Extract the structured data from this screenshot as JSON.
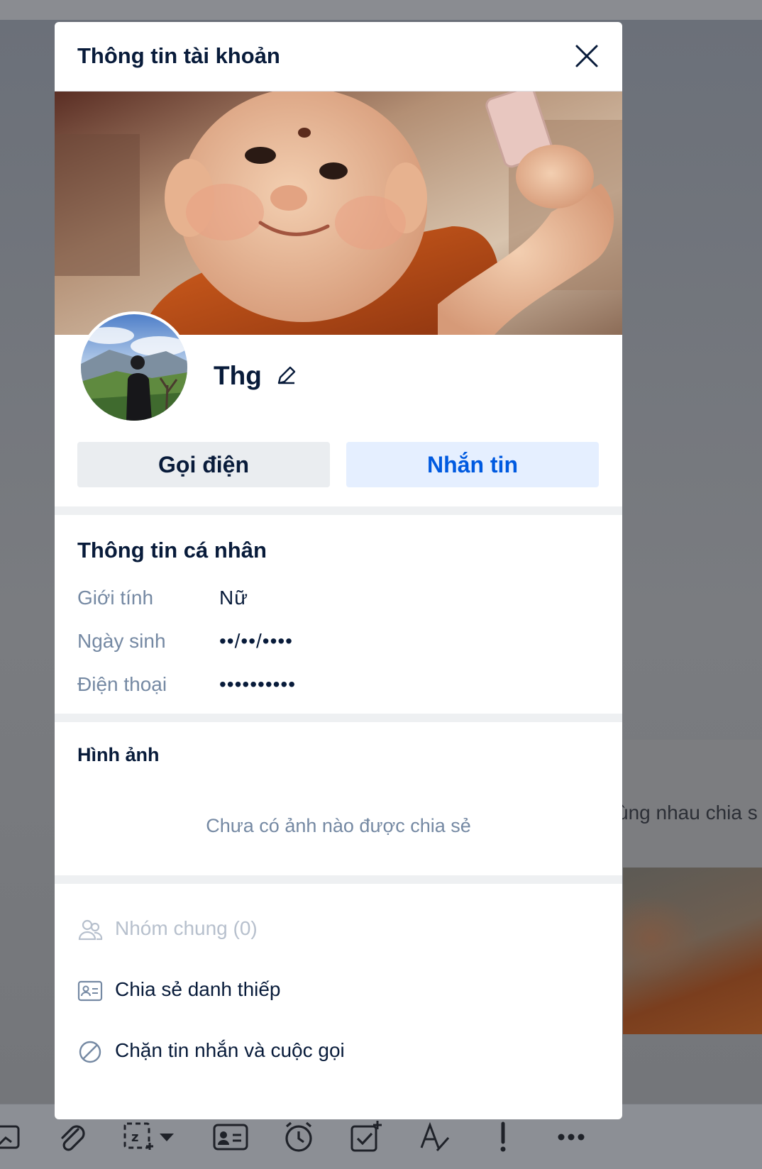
{
  "modal": {
    "title": "Thông tin tài khoản"
  },
  "profile": {
    "name": "Thg"
  },
  "buttons": {
    "call": "Gọi điện",
    "message": "Nhắn tin"
  },
  "personal_info": {
    "title": "Thông tin cá nhân",
    "rows": [
      {
        "label": "Giới tính",
        "value": "Nữ"
      },
      {
        "label": "Ngày sinh",
        "value": "••/••/••••"
      },
      {
        "label": "Điện thoại",
        "value": "••••••••••"
      }
    ]
  },
  "photos": {
    "title": "Hình ảnh",
    "empty_text": "Chưa có ảnh nào được chia sẻ"
  },
  "actions": [
    {
      "label": "Nhóm chung (0)",
      "icon": "group-icon",
      "enabled": false
    },
    {
      "label": "Chia sẻ danh thiếp",
      "icon": "contact-card-icon",
      "enabled": true
    },
    {
      "label": "Chặn tin nhắn và cuộc gọi",
      "icon": "block-icon",
      "enabled": true
    }
  ],
  "background": {
    "card_text": "ùng nhau chia s"
  },
  "toolbar_icons": [
    "image-icon",
    "attachment-icon",
    "screenshot-icon",
    "dropdown-arrow-icon",
    "contact-card-icon",
    "reminder-clock-icon",
    "task-icon",
    "text-format-icon",
    "urgent-icon",
    "more-icon"
  ],
  "colors": {
    "primary_text": "#081b3a",
    "secondary_text": "#7589a3",
    "accent_blue": "#005ae0",
    "message_button_bg": "#e5efff",
    "call_button_bg": "#eaedf0"
  }
}
